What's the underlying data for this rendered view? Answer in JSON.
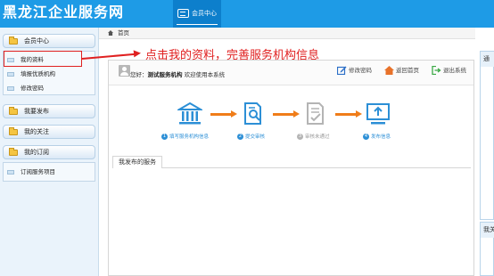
{
  "header": {
    "brand": "黑龙江企业服务网",
    "tab_label": "会员中心"
  },
  "sidebar": {
    "sections": [
      {
        "label": "会员中心",
        "items": [
          "我的资料",
          "填报优质机构",
          "修改密码"
        ]
      },
      {
        "label": "我要发布",
        "items": []
      },
      {
        "label": "我的关注",
        "items": []
      },
      {
        "label": "我的订阅",
        "items": [
          "订阅服务项目"
        ]
      }
    ]
  },
  "annotation": "点击我的资料，完善服务机构信息",
  "breadcrumb": {
    "home": "首页"
  },
  "topbar": {
    "greeting_prefix": "您好：",
    "org_name": "测试服务机构",
    "greeting_suffix": "欢迎使用本系统",
    "actions": [
      {
        "label": "修改密码",
        "icon": "edit-icon",
        "color": "#2b6fc7"
      },
      {
        "label": "返回首页",
        "icon": "home-icon",
        "color": "#e8722a"
      },
      {
        "label": "退出系统",
        "icon": "logout-icon",
        "color": "#3aa845"
      }
    ]
  },
  "steps": [
    {
      "num": "1",
      "label": "填写服务机构信息",
      "state": "active"
    },
    {
      "num": "2",
      "label": "提交审核",
      "state": "active"
    },
    {
      "num": "3",
      "label": "审核未通过",
      "state": "inactive"
    },
    {
      "num": "4",
      "label": "发布信息",
      "state": "active"
    }
  ],
  "tabs": [
    "我发布的服务"
  ],
  "right_panels": [
    "通",
    "我关"
  ],
  "colors": {
    "header_bg": "#1e9be6",
    "step_blue": "#2c8fd6",
    "step_orange": "#f07d19",
    "step_grey": "#b4b4b4",
    "annotation_red": "#e02020"
  }
}
